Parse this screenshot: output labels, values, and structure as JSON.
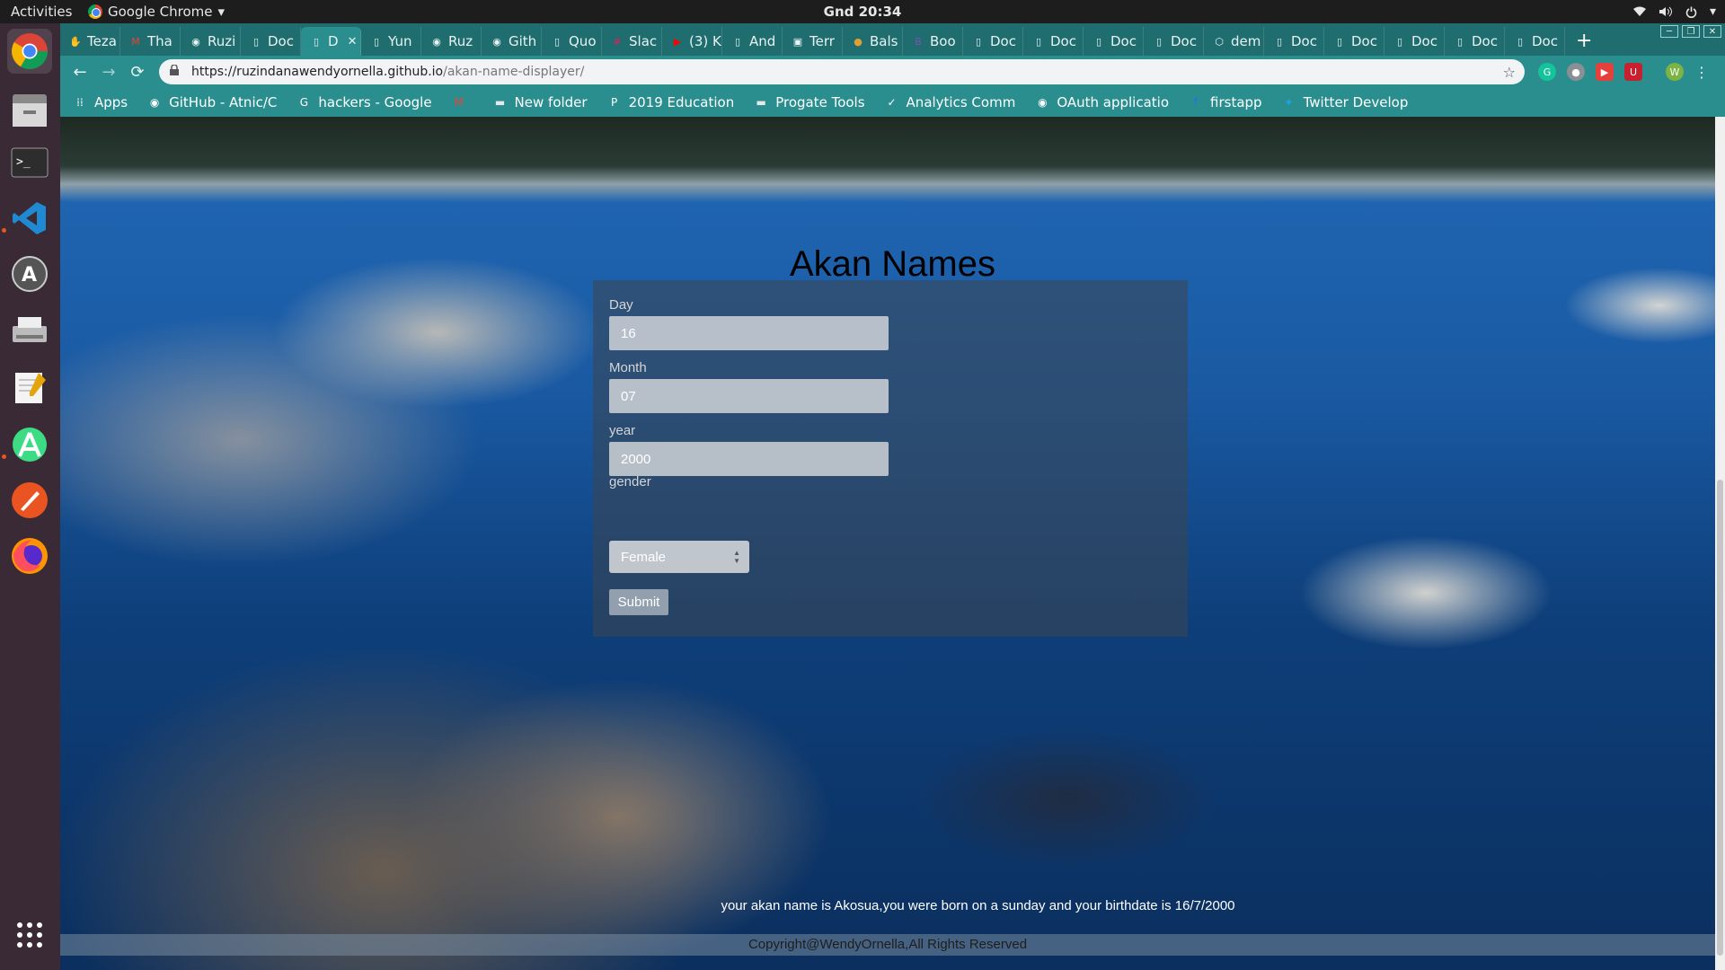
{
  "topbar": {
    "activities": "Activities",
    "app_name": "Google Chrome",
    "app_menu_arrow": "▾",
    "clock": "Gnd 20:34",
    "tray_icons": [
      "wifi-icon",
      "volume-icon",
      "power-icon"
    ]
  },
  "dock": {
    "items": [
      "chrome-icon",
      "file-manager-icon",
      "terminal-icon",
      "vscode-icon",
      "software-updater-icon",
      "scanner-icon",
      "text-editor-icon",
      "android-studio-icon",
      "sketch-icon",
      "firefox-icon"
    ],
    "show_apps": "show-apps-icon"
  },
  "tabs": [
    {
      "label": "Teza",
      "icon": "hand-icon"
    },
    {
      "label": "Tha",
      "icon": "gmail-icon"
    },
    {
      "label": "Ruzi",
      "icon": "github-icon"
    },
    {
      "label": "Doc",
      "icon": "page-icon"
    },
    {
      "label": "D",
      "icon": "page-icon",
      "active": true,
      "close": "✕"
    },
    {
      "label": "Yun",
      "icon": "page-icon"
    },
    {
      "label": "Ruz",
      "icon": "github-icon"
    },
    {
      "label": "Gith",
      "icon": "github-icon"
    },
    {
      "label": "Quo",
      "icon": "page-icon"
    },
    {
      "label": "Slac",
      "icon": "slack-icon"
    },
    {
      "label": "(3) K",
      "icon": "youtube-icon"
    },
    {
      "label": "And",
      "icon": "page-icon"
    },
    {
      "label": "Terr",
      "icon": "terminal-icon"
    },
    {
      "label": "Bals",
      "icon": "circle-icon"
    },
    {
      "label": "Boo",
      "icon": "bootstrap-icon"
    },
    {
      "label": "Doc",
      "icon": "page-icon"
    },
    {
      "label": "Doc",
      "icon": "page-icon"
    },
    {
      "label": "Doc",
      "icon": "page-icon"
    },
    {
      "label": "Doc",
      "icon": "page-icon"
    },
    {
      "label": "dem",
      "icon": "codepen-icon"
    },
    {
      "label": "Doc",
      "icon": "page-icon"
    },
    {
      "label": "Doc",
      "icon": "page-icon"
    },
    {
      "label": "Doc",
      "icon": "page-icon"
    },
    {
      "label": "Doc",
      "icon": "page-icon"
    },
    {
      "label": "Doc",
      "icon": "page-icon"
    }
  ],
  "omnibox": {
    "host": "https://ruzindanawendyornella.github.io",
    "path": "/akan-name-displayer/"
  },
  "bookmarks": [
    {
      "label": "Apps",
      "icon": "apps-grid-icon"
    },
    {
      "label": "GitHub - Atnic/C",
      "icon": "github-icon"
    },
    {
      "label": "hackers - Google",
      "icon": "google-icon"
    },
    {
      "label": "",
      "icon": "gmail-icon"
    },
    {
      "label": "New folder",
      "icon": "folder-icon"
    },
    {
      "label": "2019 Education",
      "icon": "p-icon"
    },
    {
      "label": "Progate Tools",
      "icon": "folder-icon"
    },
    {
      "label": "Analytics Comm",
      "icon": "analytics-icon"
    },
    {
      "label": "OAuth applicatio",
      "icon": "github-icon"
    },
    {
      "label": "firstapp",
      "icon": "facebook-icon"
    },
    {
      "label": "Twitter Develop",
      "icon": "twitter-icon"
    }
  ],
  "page": {
    "title": "Akan Names",
    "form": {
      "day_label": "Day",
      "day_value": "16",
      "month_label": "Month",
      "month_value": "07",
      "year_label": "year",
      "year_value": "2000",
      "gender_label": "gender",
      "gender_value": "Female",
      "submit_label": "Submit"
    },
    "result": "your akan name is Akosua,you were born on a sunday and your birthdate is 16/7/2000",
    "footer": "Copyright@WendyOrnella,All Rights Reserved"
  },
  "colors": {
    "tab_strip": "#1f6d6f",
    "toolbar": "#2a8e8f",
    "dock": "#3a2a35",
    "accent_orange": "#e95420"
  }
}
